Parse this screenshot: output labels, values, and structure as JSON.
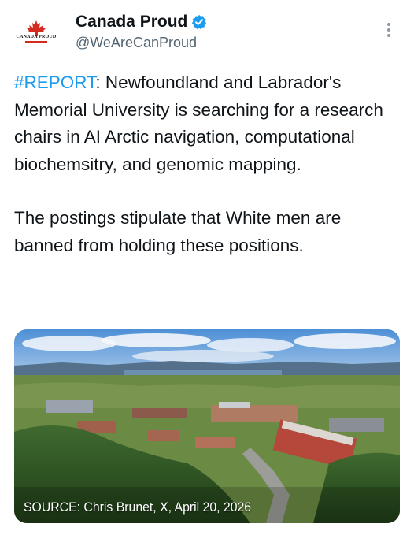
{
  "post": {
    "author": {
      "display_name": "Canada Proud",
      "handle": "@WeAreCanProud",
      "verified": true,
      "avatar_text": "CANADA PROUD",
      "avatar_icon": "maple-leaf-icon"
    },
    "menu_icon": "more-vertical-icon",
    "hashtag": "#REPORT",
    "body_line1": ": Newfoundland and Labrador's Memorial University is searching for a research chairs in AI Arctic navigation, computational biochemsitry, and genomic mapping.",
    "body_paragraph2": "The postings stipulate that White men are banned from holding these positions.",
    "media": {
      "caption": "SOURCE: Chris Brunet, X, April 20, 2026"
    }
  },
  "colors": {
    "hashtag": "#1d9bf0",
    "verified": "#1d9bf0",
    "text": "#0f1419",
    "secondary": "#536471",
    "maple_red": "#d52b1e"
  }
}
